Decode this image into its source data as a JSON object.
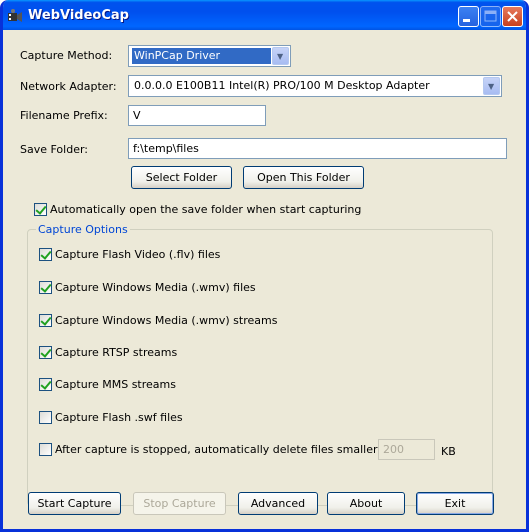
{
  "window": {
    "title": "WebVideoCap"
  },
  "form": {
    "capture_method_label": "Capture Method:",
    "capture_method_value": "WinPCap Driver",
    "network_adapter_label": "Network Adapter:",
    "network_adapter_value": "0.0.0.0   E100B11 Intel(R) PRO/100 M Desktop Adapter",
    "filename_prefix_label": "Filename Prefix:",
    "filename_prefix_value": "V",
    "save_folder_label": "Save Folder:",
    "save_folder_value": "f:\\temp\\files",
    "select_folder_label": "Select Folder",
    "open_folder_label": "Open This Folder",
    "auto_open_label": "Automatically open the save folder when start capturing"
  },
  "capture_options": {
    "legend": "Capture Options",
    "flv": "Capture Flash Video (.flv) files",
    "wmv_files": "Capture Windows Media (.wmv) files",
    "wmv_streams": "Capture Windows Media (.wmv) streams",
    "rtsp": "Capture RTSP streams",
    "mms": "Capture MMS streams",
    "swf": "Capture Flash .swf files",
    "auto_delete": "After capture is stopped, automatically delete files smaller than:",
    "size_value": "200",
    "size_unit": "KB"
  },
  "checks": {
    "auto_open": true,
    "flv": true,
    "wmv_files": true,
    "wmv_streams": true,
    "rtsp": true,
    "mms": true,
    "swf": false,
    "auto_delete": false
  },
  "buttons": {
    "start": "Start Capture",
    "stop": "Stop Capture",
    "advanced": "Advanced",
    "about": "About",
    "exit": "Exit"
  },
  "colors": {
    "title_blue": "#0054e3",
    "window_bg": "#ece9d8",
    "legend_blue": "#0046d5",
    "check_green": "#21a121"
  },
  "icons": {
    "app": "film-capture-icon",
    "minimize": "minimize-icon",
    "maximize": "maximize-icon",
    "close": "close-icon"
  }
}
